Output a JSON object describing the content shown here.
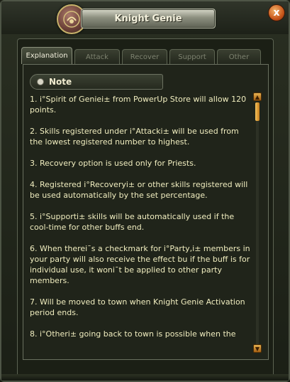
{
  "window": {
    "title": "Knight Genie",
    "close_label": "x"
  },
  "tabs": [
    {
      "label": "Explanation",
      "active": true
    },
    {
      "label": "Attack",
      "active": false
    },
    {
      "label": "Recover",
      "active": false
    },
    {
      "label": "Support",
      "active": false
    },
    {
      "label": "Other",
      "active": false
    }
  ],
  "note": {
    "label": "Note"
  },
  "paragraphs": [
    "1. i°Spirit of Geniei± from PowerUp Store will allow 120 points.",
    "2. Skills registered under i°Attacki± will be used from the lowest registered number to highest.",
    "3. Recovery option is used only for Priests.",
    "4. Registered i°Recoveryi± or other skills registered will be used automatically by the set percentage.",
    "5.  i°Supporti± skills will be automatically used if the cool-time for other buffs end.",
    "6. When therei¯s a checkmark for i°Party,i± members in your party will also receive the effect bu if the buff is for individual use, it woni¯t be applied to other party members.",
    "7. Will be moved to town when Knight Genie Activation period ends.",
    "8. i°Otheri± going back to town is possible when the"
  ],
  "icons": {
    "emblem": "genie-emblem-icon",
    "scroll_up": "arrow-up-icon",
    "scroll_down": "arrow-down-icon"
  },
  "colors": {
    "text": "#f0edbf",
    "accent_button": "#e7b251",
    "close_button": "#c8561a"
  }
}
